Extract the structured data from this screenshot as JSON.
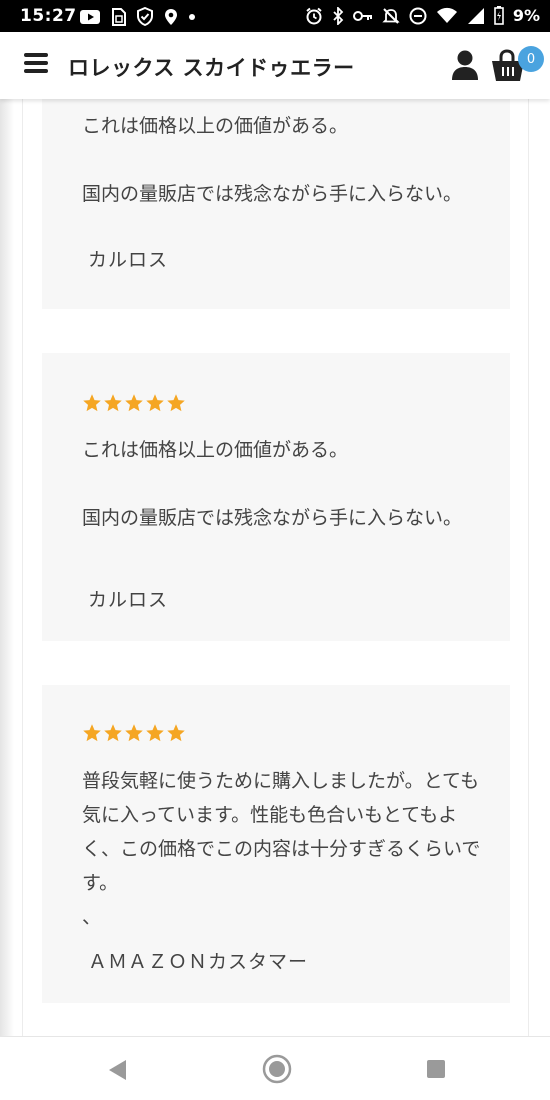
{
  "status_bar": {
    "time": "15:27",
    "battery": "9%",
    "left_icons": [
      "youtube-icon",
      "sim-icon",
      "shield-check-icon",
      "location-icon",
      "dot-icon"
    ],
    "right_icons": [
      "alarm-icon",
      "bluetooth-icon",
      "key-icon",
      "bell-off-icon",
      "do-not-disturb-icon",
      "wifi-icon",
      "signal-icon",
      "battery-icon"
    ]
  },
  "header": {
    "title": "ロレックス スカイドゥエラー",
    "cart_count": "0",
    "icons": [
      "menu-icon",
      "user-icon",
      "cart-icon"
    ]
  },
  "reviews": [
    {
      "stars": 0,
      "text": "これは価格以上の価値がある。\n\n国内の量販店では残念ながら手に入らない。",
      "author": "カルロス"
    },
    {
      "stars": 5,
      "text": "これは価格以上の価値がある。\n\n国内の量販店では残念ながら手に入らない。",
      "author": "カルロス"
    },
    {
      "stars": 5,
      "text": "普段気軽に使うために購入しましたが。とても気に入っています。性能も色合いもとてもよく、この価格でこの内容は十分すぎるくらいです。\n、",
      "author": "ＡＭＡＺＯＮカスタマー"
    }
  ],
  "colors": {
    "star": "#f5a623",
    "badge": "#4aa3df",
    "card_bg": "#f7f7f7",
    "text": "#444444"
  },
  "nav_bar": {
    "icons": [
      "back-icon",
      "home-icon",
      "recent-apps-icon"
    ]
  }
}
